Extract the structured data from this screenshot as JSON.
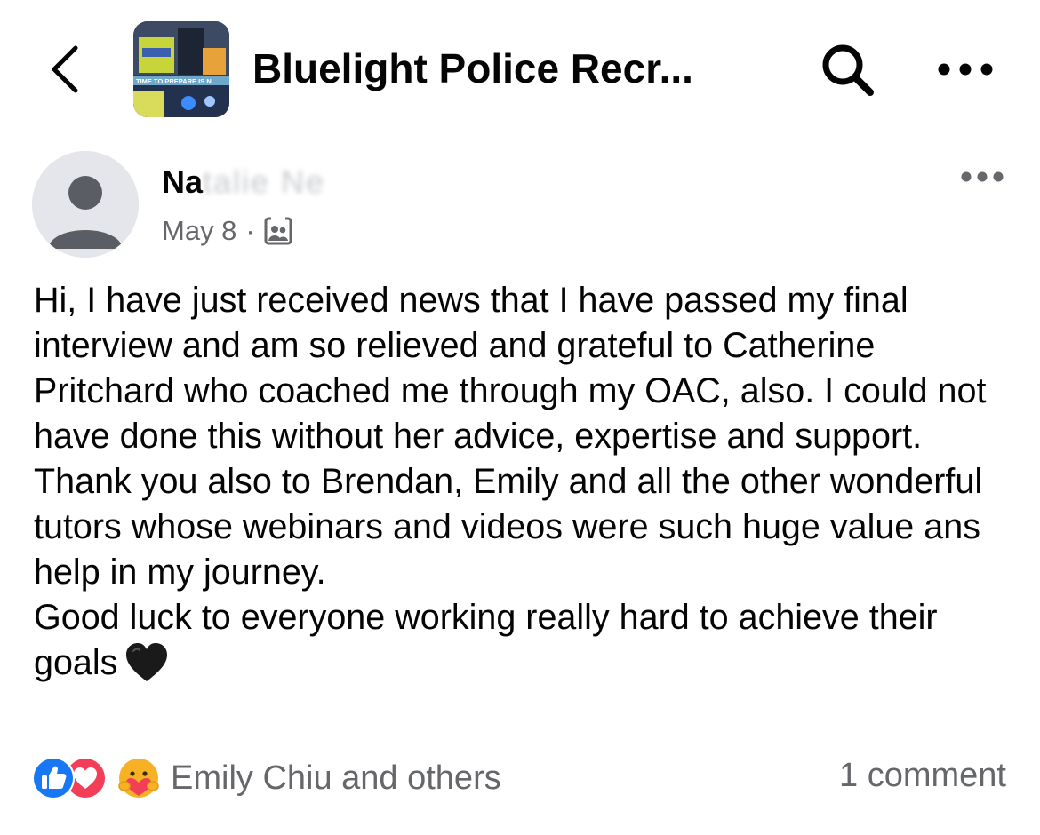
{
  "header": {
    "title": "Bluelight Police Recr...",
    "thumbnail_banner_text": "TIME TO PREPARE IS N"
  },
  "post": {
    "author_visible": "Na",
    "author_obscured": "talie Ne",
    "date": "May 8",
    "separator": "·",
    "audience_icon": "group-members-icon",
    "paragraphs": [
      "Hi, I have just received news that I have passed my final interview and am so relieved and grateful to Catherine Pritchard who coached me through my OAC, also.  I could not have done this without her advice, expertise and support.",
      "Thank you also to Brendan, Emily and all the other wonderful tutors whose webinars and videos were such huge value ans help in my journey.",
      "Good luck to everyone working really hard to achieve their goals"
    ],
    "trailing_emoji": "black-heart"
  },
  "footer": {
    "reaction_types": [
      "like",
      "love",
      "care"
    ],
    "reactions_text": "Emily Chiu and others",
    "comments_text": "1 comment"
  },
  "colors": {
    "text_primary": "#050505",
    "text_secondary": "#65676b",
    "like_blue": "#1877f2",
    "love_red": "#f33e58",
    "care_yellow": "#f7b125"
  }
}
